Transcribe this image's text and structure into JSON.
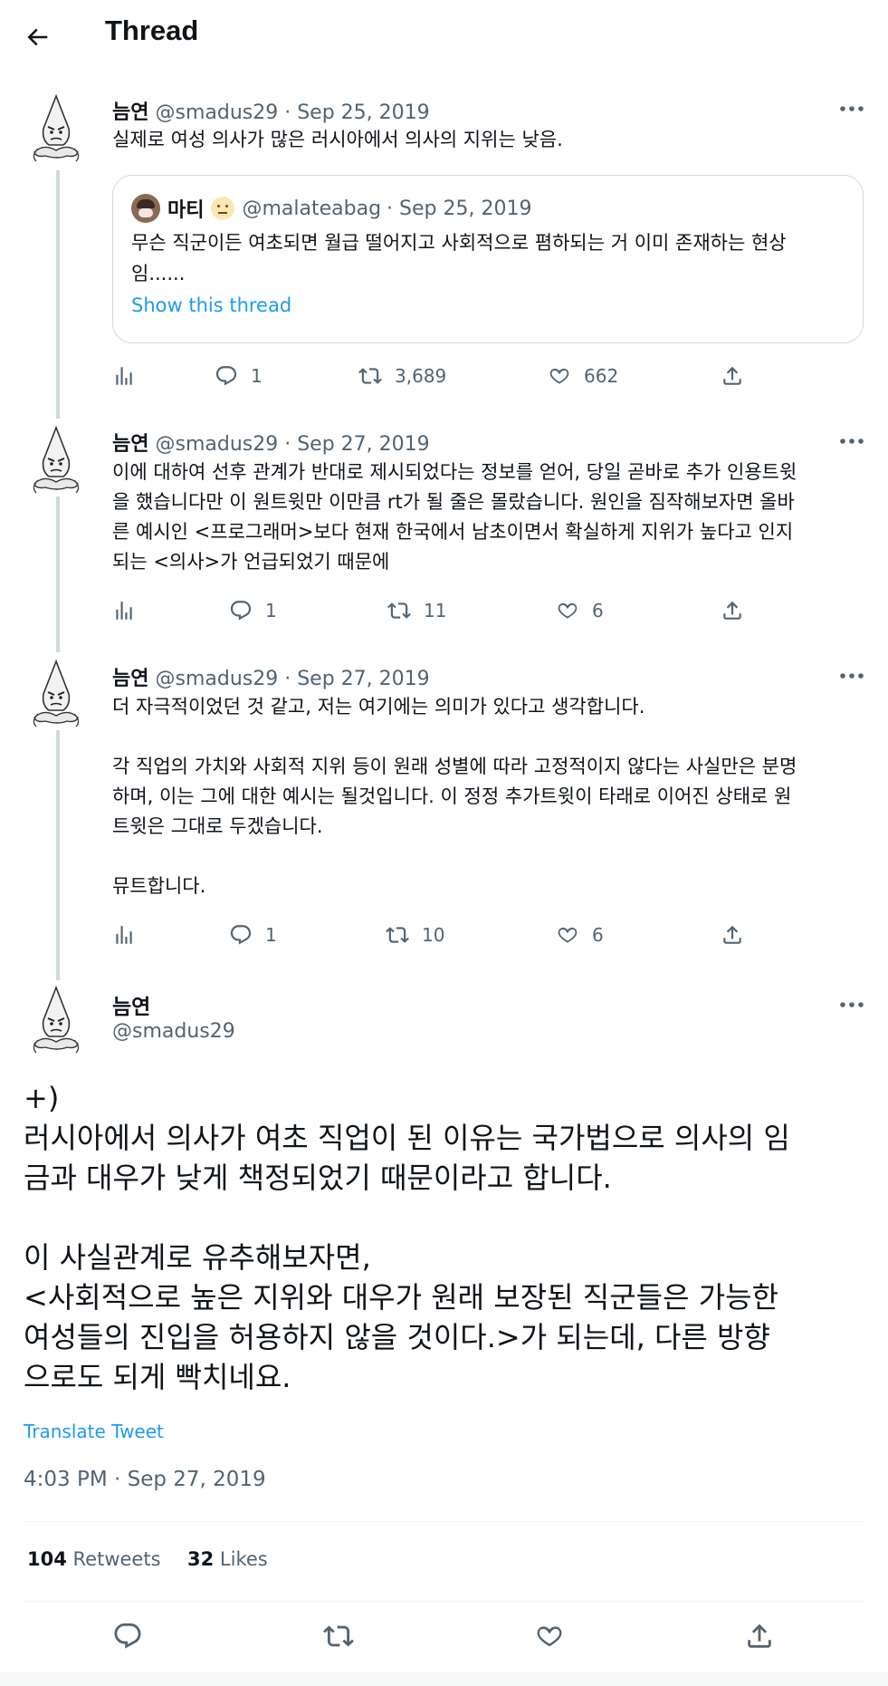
{
  "header": {
    "title": "Thread"
  },
  "tweets": [
    {
      "name": "늠연",
      "handle": "@smadus29",
      "date": "· Sep 25, 2019",
      "text": "실제로 여성 의사가 많은 러시아에서 의사의 지위는 낮음.",
      "quote": {
        "name": "마티",
        "handle": "@malateabag",
        "date": "· Sep 25, 2019",
        "text": "무슨 직군이든 여초되면 월급 떨어지고 사회적으로 폄하되는 거 이미 존재하는 현상\n임......",
        "show_thread": "Show this thread"
      },
      "replies": "1",
      "retweets": "3,689",
      "likes": "662"
    },
    {
      "name": "늠연",
      "handle": "@smadus29",
      "date": "· Sep 27, 2019",
      "text": "이에 대하여 선후 관계가 반대로 제시되었다는 정보를 얻어, 당일 곧바로 추가 인용트윗\n을 했습니다만 이 원트윗만 이만큼 rt가 될 줄은 몰랐습니다. 원인을 짐작해보자면 올바\n른 예시인 <프로그래머>보다 현재 한국에서 남초이면서 확실하게 지위가 높다고 인지\n되는 <의사>가 언급되었기 때문에",
      "replies": "1",
      "retweets": "11",
      "likes": "6"
    },
    {
      "name": "늠연",
      "handle": "@smadus29",
      "date": "· Sep 27, 2019",
      "text": "더 자극적이었던 것 같고, 저는 여기에는 의미가 있다고 생각합니다.\n\n각 직업의 가치와 사회적 지위 등이 원래 성별에 따라 고정적이지 않다는 사실만은 분명\n하며, 이는 그에 대한 예시는 될것입니다. 이 정정 추가트윗이 타래로 이어진 상태로 원\n트윗은 그대로 두겠습니다.\n\n뮤트합니다.",
      "replies": "1",
      "retweets": "10",
      "likes": "6"
    }
  ],
  "main_tweet": {
    "name": "늠연",
    "handle": "@smadus29",
    "text": "+)\n러시아에서 의사가 여초 직업이 된 이유는 국가법으로 의사의 임\n금과 대우가 낮게 책정되었기 때문이라고 합니다.\n\n이 사실관계로 유추해보자면,\n<사회적으로 높은 지위와 대우가 원래 보장된 직군들은 가능한\n여성들의 진입을 허용하지 않을 것이다.>가 되는데, 다른 방향\n으로도 되게 빡치네요.",
    "translate": "Translate Tweet",
    "timestamp": "4:03 PM · Sep 27, 2019",
    "retweet_count": "104",
    "retweet_label": "Retweets",
    "like_count": "32",
    "like_label": "Likes"
  },
  "colors": {
    "accent": "#1d9bf0",
    "muted": "#536471",
    "border": "#cfd9de",
    "text": "#0f1419"
  },
  "icons": [
    "back-arrow-icon",
    "more-icon",
    "analytics-icon",
    "reply-icon",
    "retweet-icon",
    "like-icon",
    "share-icon"
  ]
}
